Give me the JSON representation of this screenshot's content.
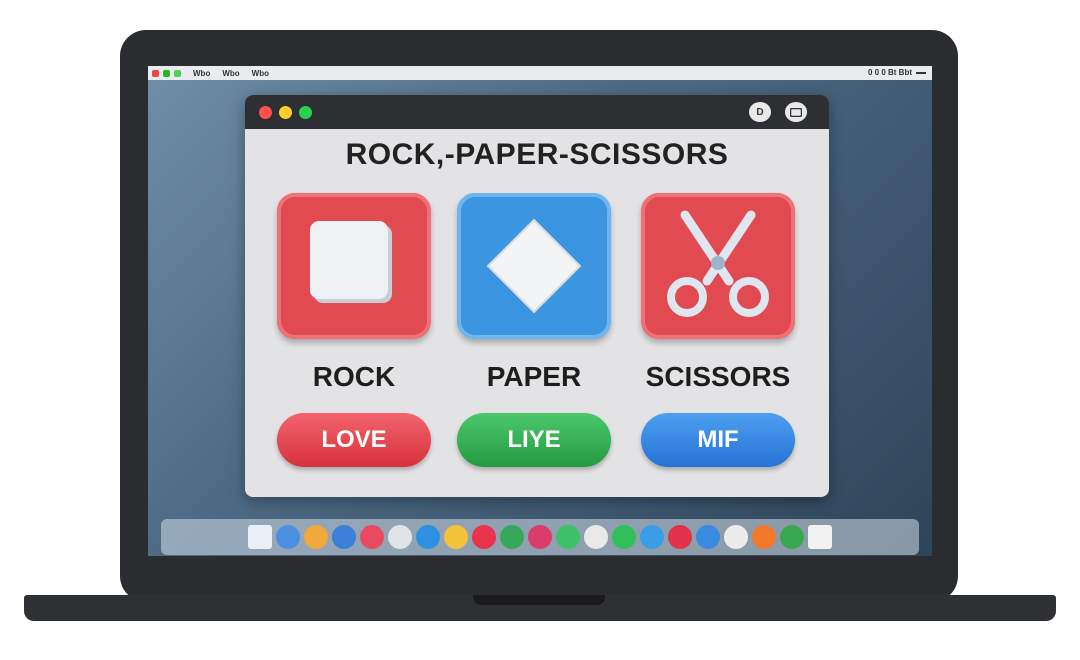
{
  "menubar": {
    "items": [
      "Wbo",
      "Wbo",
      "Wbo"
    ],
    "status": "0 0 0 Bt Bbt"
  },
  "window": {
    "title": "ROCK,-PAPER-SCISSORS",
    "toolbar_button_1": "D"
  },
  "choices": [
    {
      "label": "ROCK",
      "color": "#e24a52"
    },
    {
      "label": "PAPER",
      "color": "#3b95e0"
    },
    {
      "label": "SCISSORS",
      "color": "#e24a52"
    }
  ],
  "actions": [
    {
      "label": "LOVE",
      "color": "#e2414c"
    },
    {
      "label": "LIYE",
      "color": "#2fae4f"
    },
    {
      "label": "MIF",
      "color": "#2f82e0"
    }
  ],
  "dock_icons": [
    "finder-icon",
    "safari-icon",
    "compass-icon",
    "mail-icon",
    "music-icon",
    "photos-icon",
    "app-store-icon",
    "notes-icon",
    "games-icon",
    "maps-icon",
    "scripts-icon",
    "messages-icon",
    "home-icon",
    "facetime-icon",
    "edge-icon",
    "news-icon",
    "sharing-icon",
    "cloud-icon",
    "warning-icon",
    "android-icon",
    "trash-icon"
  ]
}
